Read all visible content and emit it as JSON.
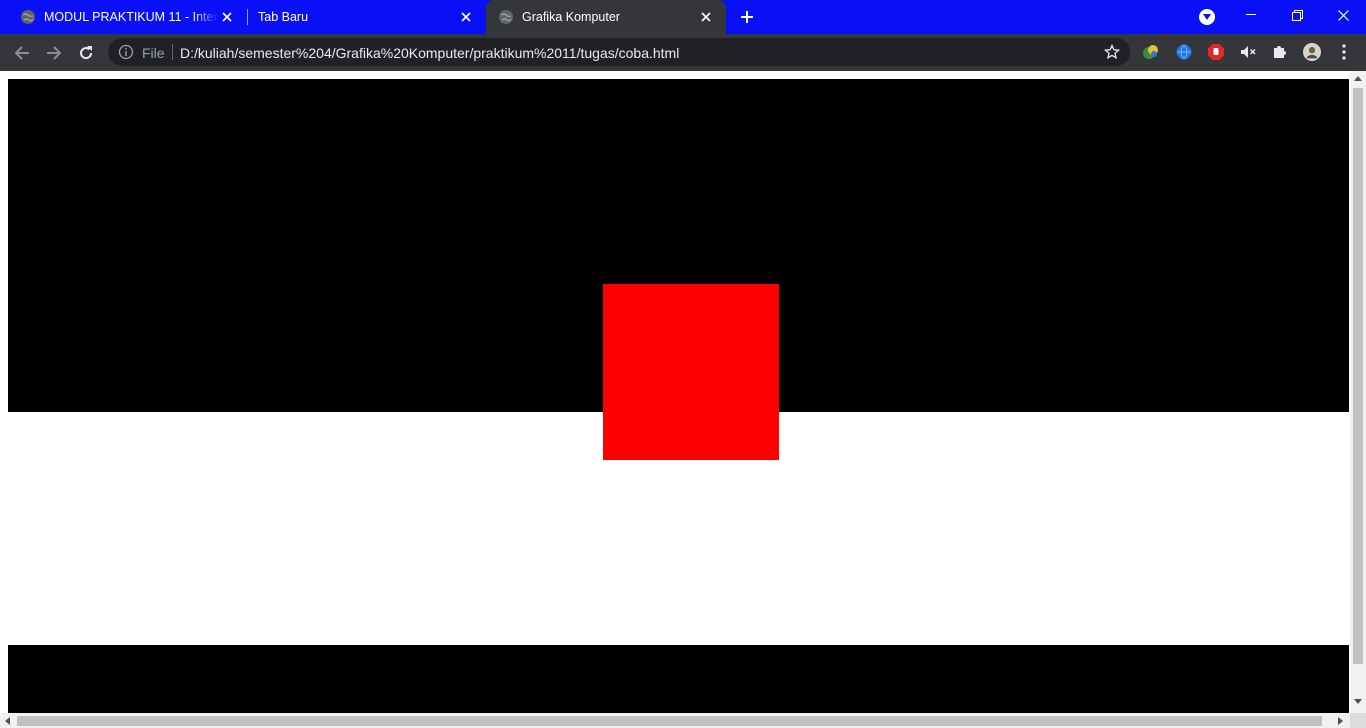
{
  "browser": {
    "tabs": [
      {
        "title": "MODUL PRAKTIKUM 11 - Interaktif",
        "icon": "globe-icon",
        "active": false
      },
      {
        "title": "Tab Baru",
        "icon": "",
        "active": false
      },
      {
        "title": "Grafika Komputer",
        "icon": "globe-icon",
        "active": true
      }
    ],
    "address": {
      "scheme_label": "File",
      "url": "D:/kuliah/semester%204/Grafika%20Komputer/praktikum%2011/tugas/coba.html"
    },
    "colors": {
      "tabstrip": "#0a10f5",
      "toolbar": "#35363a",
      "omnibox": "#202124"
    }
  },
  "page": {
    "background": "#ffffff",
    "canvas_color": "#000000",
    "square_color": "#ff0000"
  }
}
